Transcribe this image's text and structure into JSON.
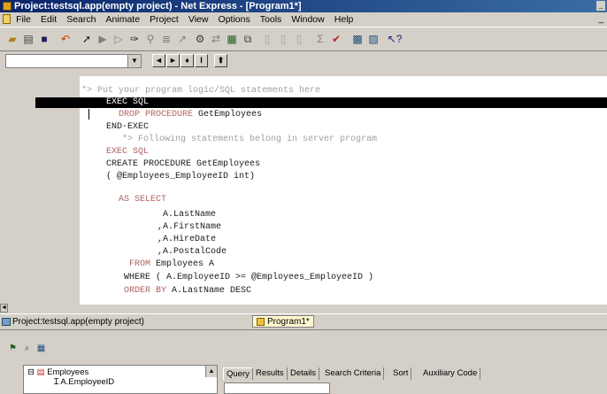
{
  "window": {
    "title": "Project:testsql.app(empty project) - Net Express - [Program1*]"
  },
  "menu": [
    "File",
    "Edit",
    "Search",
    "Animate",
    "Project",
    "View",
    "Options",
    "Tools",
    "Window",
    "Help"
  ],
  "toolbar_icons": [
    "open-folder-icon",
    "new-file-icon",
    "save-icon",
    "undo-icon",
    "run-icon",
    "step-icon",
    "breakpoint-icon",
    "wand-icon",
    "find-icon",
    "sort-icon",
    "cursor-icon",
    "build-icon",
    "rebuild-icon",
    "compile-icon",
    "link-icon",
    "page1-icon",
    "page2-icon",
    "page3-icon",
    "sigma-icon",
    "check-icon",
    "sql-icon",
    "sql-assist-icon",
    "help-pointer-icon"
  ],
  "nav_buttons": [
    "◄",
    "►",
    "♦",
    "I",
    "⬆"
  ],
  "code": {
    "lines": [
      {
        "text": "*> Put your program logic/SQL statements here",
        "kind": "comment"
      },
      {
        "text": "EXEC SQL",
        "kind": "exec"
      },
      {
        "text": "DROP PROCEDURE GetEmployees",
        "kind": "mixed",
        "kw": "DROP PROCEDURE",
        "rest": " GetEmployees"
      },
      {
        "text": "END-EXEC",
        "kind": "plain"
      },
      {
        "text": "*> Following statements belong in server program",
        "kind": "comment"
      },
      {
        "text": "EXEC SQL",
        "kind": "keyword"
      },
      {
        "text": "CREATE PROCEDURE GetEmployees",
        "kind": "plain"
      },
      {
        "text": "( @Employees_EmployeeID int)",
        "kind": "plain"
      },
      {
        "text": "AS SELECT",
        "kind": "keyword"
      },
      {
        "text": "A.LastName",
        "kind": "plain"
      },
      {
        "text": ",A.FirstName",
        "kind": "plain"
      },
      {
        "text": ",A.HireDate",
        "kind": "plain"
      },
      {
        "text": ",A.PostalCode",
        "kind": "plain"
      },
      {
        "text": "FROM Employees A",
        "kind": "mixed",
        "kw": "FROM",
        "rest": " Employees A"
      },
      {
        "text": "WHERE ( A.EmployeeID >= @Employees_EmployeeID )",
        "kind": "plain"
      },
      {
        "text": "ORDER BY A.LastName DESC",
        "kind": "mixed",
        "kw": "ORDER BY",
        "rest": " A.LastName DESC"
      }
    ]
  },
  "status": {
    "project": "Project:testsql.app(empty project)",
    "tab": "Program1*"
  },
  "bottom": {
    "tree": [
      "Employees",
      "A.EmployeeID"
    ],
    "tabs": [
      "Query",
      "Results",
      "Details",
      "Search Criteria",
      "Sort",
      "Auxiliary Code"
    ]
  },
  "colors": {
    "comment": "#a0a0a0",
    "keyword": "#b06060",
    "text": "#1a1a1a",
    "title_start": "#0a246a"
  }
}
